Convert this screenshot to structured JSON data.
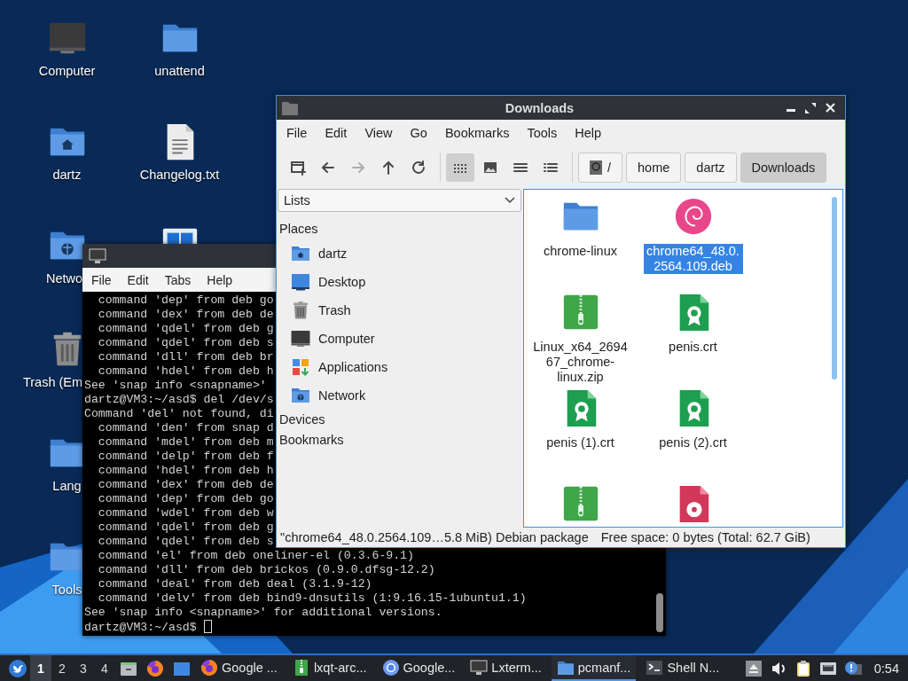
{
  "desktop": {
    "icons": [
      {
        "label": "Computer",
        "kind": "computer"
      },
      {
        "label": "dartz",
        "kind": "home-folder"
      },
      {
        "label": "Netwo",
        "kind": "network-folder"
      },
      {
        "label": "Trash (Em",
        "kind": "trash"
      },
      {
        "label": "Lang",
        "kind": "folder"
      },
      {
        "label": "Tools",
        "kind": "folder"
      },
      {
        "label": "unattend",
        "kind": "folder"
      },
      {
        "label": "Changelog.txt",
        "kind": "text-file"
      },
      {
        "kind": "windows-tile"
      }
    ]
  },
  "terminal": {
    "menu": [
      "File",
      "Edit",
      "Tabs",
      "Help"
    ],
    "lines": [
      "  command 'dep' from deb go",
      "  command 'dex' from deb de",
      "  command 'qdel' from deb g",
      "  command 'qdel' from deb s",
      "  command 'dll' from deb br",
      "  command 'hdel' from deb h",
      "See 'snap info <snapname>'",
      "dartz@VM3:~/asd$ del /dev/s",
      "Command 'del' not found, di",
      "  command 'den' from snap d",
      "  command 'mdel' from deb m",
      "  command 'delp' from deb f",
      "  command 'hdel' from deb h",
      "  command 'dex' from deb de",
      "  command 'dep' from deb go",
      "  command 'wdel' from deb w",
      "  command 'qdel' from deb g",
      "  command 'qdel' from deb s",
      "  command 'el' from deb oneliner-el (0.3.6-9.1)",
      "  command 'dll' from deb brickos (0.9.0.dfsg-12.2)",
      "  command 'deal' from deb deal (3.1.9-12)",
      "  command 'delv' from deb bind9-dnsutils (1:9.16.15-1ubuntu1.1)",
      "See 'snap info <snapname>' for additional versions."
    ],
    "prompt": "dartz@VM3:~/asd$"
  },
  "file_manager": {
    "title": "Downloads",
    "menu": [
      "File",
      "Edit",
      "View",
      "Go",
      "Bookmarks",
      "Tools",
      "Help"
    ],
    "nav_buttons": [
      {
        "kind": "new-window",
        "disabled": false
      },
      {
        "kind": "back",
        "disabled": false
      },
      {
        "kind": "forward",
        "disabled": true
      },
      {
        "kind": "up",
        "disabled": false
      },
      {
        "kind": "reload",
        "disabled": false
      }
    ],
    "view_modes": [
      {
        "kind": "icons",
        "selected": true
      },
      {
        "kind": "thumbnails",
        "selected": false
      },
      {
        "kind": "compact",
        "selected": false
      },
      {
        "kind": "details",
        "selected": false
      }
    ],
    "path": [
      {
        "label": "/",
        "kind": "root",
        "selected": false
      },
      {
        "label": "home",
        "kind": "dir",
        "selected": false
      },
      {
        "label": "dartz",
        "kind": "dir",
        "selected": false
      },
      {
        "label": "Downloads",
        "kind": "dir",
        "selected": true
      }
    ],
    "side_pane": {
      "mode": "Lists",
      "sections": [
        {
          "label": "Places",
          "items": [
            {
              "label": "dartz",
              "kind": "home-folder"
            },
            {
              "label": "Desktop",
              "kind": "desktop"
            },
            {
              "label": "Trash",
              "kind": "trash"
            },
            {
              "label": "Computer",
              "kind": "computer"
            },
            {
              "label": "Applications",
              "kind": "applications"
            },
            {
              "label": "Network",
              "kind": "network-folder"
            }
          ]
        },
        {
          "label": "Devices"
        },
        {
          "label": "Bookmarks"
        }
      ]
    },
    "files": [
      {
        "name": "chrome-linux",
        "kind": "folder",
        "selected": false
      },
      {
        "name": "chrome64_48.0.2564.109.deb",
        "kind": "deb",
        "selected": true
      },
      {
        "name": "Linux_x64_269467_chrome-linux.zip",
        "kind": "zip",
        "selected": false
      },
      {
        "name": "penis.crt",
        "kind": "cert",
        "selected": false
      },
      {
        "name": "penis (1).crt",
        "kind": "cert",
        "selected": false
      },
      {
        "name": "penis (2).crt",
        "kind": "cert",
        "selected": false
      },
      {
        "kind": "zip",
        "selected": false
      },
      {
        "kind": "disk-image",
        "selected": false
      }
    ],
    "status": {
      "selection": "\"chrome64_48.0.2564.109…5.8 MiB) Debian package",
      "free_space": "Free space: 0 bytes (Total: 62.7 GiB)"
    }
  },
  "taskbar": {
    "desktops": [
      {
        "label": "1",
        "selected": true
      },
      {
        "label": "2",
        "selected": false
      },
      {
        "label": "3",
        "selected": false
      },
      {
        "label": "4",
        "selected": false
      }
    ],
    "launchers": [
      {
        "kind": "drawer"
      },
      {
        "kind": "browser"
      },
      {
        "kind": "show-desktop"
      }
    ],
    "tasks": [
      {
        "label": "Google ...",
        "kind": "browser",
        "selected": false
      },
      {
        "label": "lxqt-arc...",
        "kind": "zip",
        "selected": false
      },
      {
        "label": "Google...",
        "kind": "browser-blue",
        "selected": false
      },
      {
        "label": "Lxterm...",
        "kind": "monitor",
        "selected": false
      },
      {
        "label": "pcmanf...",
        "kind": "folder",
        "selected": true
      },
      {
        "label": "Shell N...",
        "kind": "terminal",
        "selected": false
      }
    ],
    "tray": [
      {
        "kind": "eject"
      },
      {
        "kind": "volume"
      },
      {
        "kind": "clipboard"
      },
      {
        "kind": "network"
      },
      {
        "kind": "notification"
      }
    ],
    "clock": "0:54"
  }
}
